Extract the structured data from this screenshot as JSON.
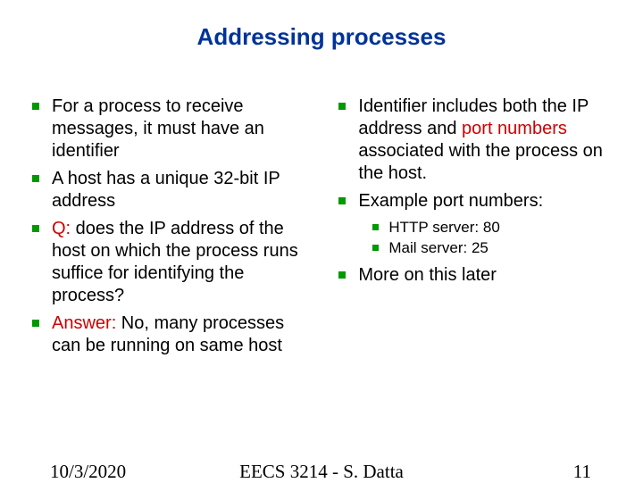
{
  "title": "Addressing processes",
  "left": {
    "b1": "For a process to receive messages, it must have an identifier",
    "b2": "A host has a unique 32-bit IP address",
    "b3_prefix": "Q:",
    "b3_rest": " does the IP address of the host on which the process runs suffice for identifying the process?",
    "b4_prefix": "Answer:",
    "b4_rest": " No, many processes can be running on same host"
  },
  "right": {
    "b1_a": "Identifier includes both the IP address and ",
    "b1_port": "port numbers",
    "b1_b": " associated with the process on the host.",
    "b2": "Example port numbers:",
    "sub1": "HTTP server: 80",
    "sub2": "Mail server: 25",
    "b3": "More on this later"
  },
  "footer": {
    "date": "10/3/2020",
    "course": "EECS 3214 - S. Datta",
    "page": "11"
  }
}
